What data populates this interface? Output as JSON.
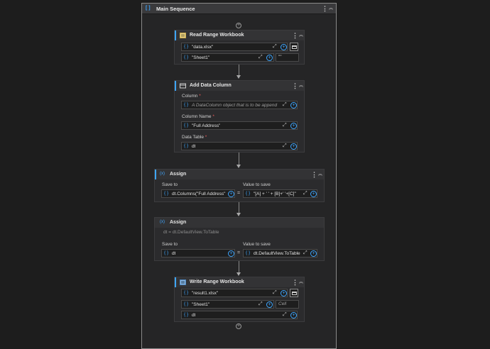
{
  "sequence": {
    "title": "Main Sequence"
  },
  "read_range": {
    "title": "Read Range Workbook",
    "workbook_path": "\"data.xlsx\"",
    "sheet_name": "\"Sheet1\"",
    "range": "\"\""
  },
  "add_column": {
    "title": "Add Data Column",
    "column_label": "Column",
    "column_placeholder": "A DataColumn object that is to be append",
    "column_name_label": "Column Name",
    "column_name_value": "\"Full Address\"",
    "data_table_label": "Data Table",
    "data_table_value": "dt"
  },
  "assign1": {
    "title": "Assign",
    "save_to_label": "Save to",
    "save_to_value": "dt.Columns(\"Full Address\"",
    "value_label": "Value to save",
    "value_value": "\"[A] + ' ' + [B]+' '+[C]\""
  },
  "assign2": {
    "title": "Assign",
    "summary": "dt = dt.DefaultView.ToTable",
    "save_to_label": "Save to",
    "save_to_value": "dt",
    "value_label": "Value to save",
    "value_value": "dt.DefaultView.ToTable"
  },
  "write_range": {
    "title": "Write Range Workbook",
    "workbook_path": "\"result1.xlsx\"",
    "sheet_name": "\"Sheet1\"",
    "cell_placeholder": "Cell",
    "data_table": "dt"
  },
  "glyphs": {
    "braces": "{ }",
    "expand": "⤢",
    "plus": "+",
    "eq": "=",
    "more": "⋮",
    "collapse": "︽"
  },
  "colors": {
    "accent": "#3ea6ff",
    "required": "#f05b5b",
    "background": "#1d1d1d"
  }
}
